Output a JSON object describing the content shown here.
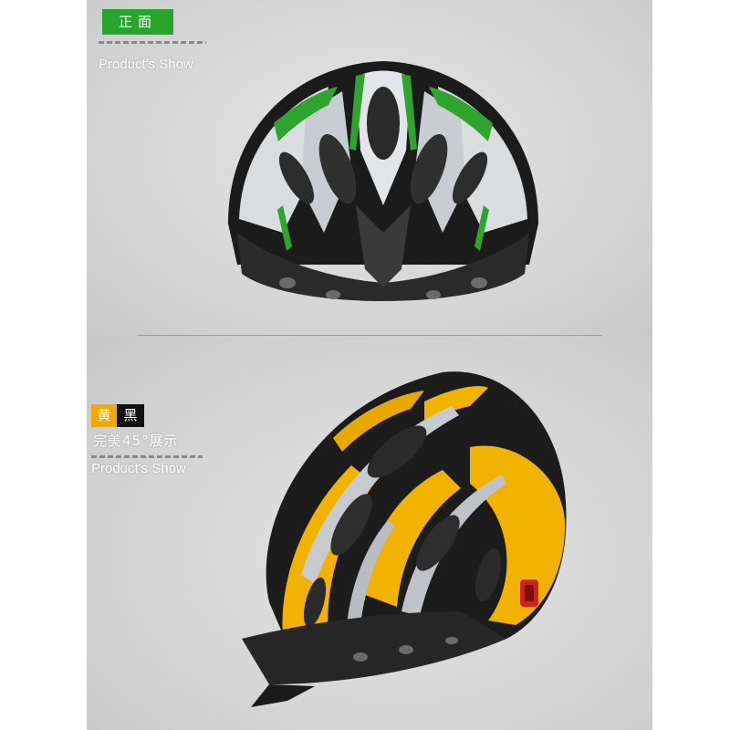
{
  "top_section": {
    "badge": "正面",
    "subtitle": "Product's Show"
  },
  "bottom_section": {
    "color_yellow": "黄",
    "color_black": "黑",
    "caption": "完美45°展示",
    "subtitle": "Product's Show"
  },
  "colors": {
    "badge_green": "#27a52d",
    "badge_yellow": "#f2a900",
    "helmet1_accent": "#2fa52f",
    "helmet2_accent": "#f2b200"
  }
}
